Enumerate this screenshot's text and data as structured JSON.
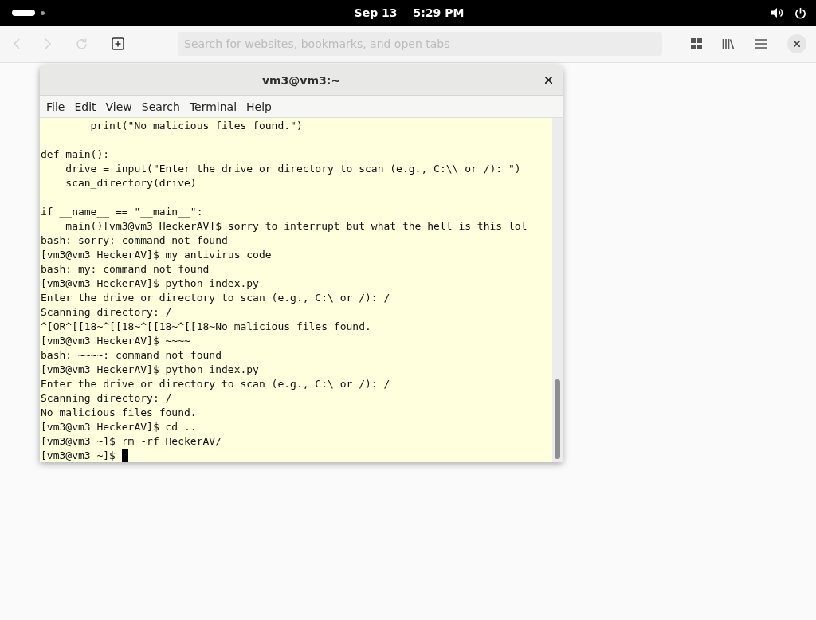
{
  "top_bar": {
    "date": "Sep 13",
    "time": "5:29 PM"
  },
  "browser": {
    "nav_buttons": [
      {
        "kind": "back",
        "disabled": true
      },
      {
        "kind": "forward",
        "disabled": true
      },
      {
        "kind": "reload",
        "disabled": true
      },
      {
        "kind": "new-tab",
        "disabled": false
      }
    ],
    "search": {
      "placeholder": "Search for websites, bookmarks, and open tabs"
    }
  },
  "terminal": {
    "title": "vm3@vm3:~",
    "menu": [
      "File",
      "Edit",
      "View",
      "Search",
      "Terminal",
      "Help"
    ],
    "blocks": [
      [
        "        print(\"No malicious files found.\")"
      ],
      [
        "def main():",
        "    drive = input(\"Enter the drive or directory to scan (e.g., C:\\\\ or /): \")",
        "    scan_directory(drive)"
      ],
      [
        "if __name__ == \"__main__\":",
        "    main()[vm3@vm3 HeckerAV]$ sorry to interrupt but what the hell is this lol",
        "bash: sorry: command not found",
        "[vm3@vm3 HeckerAV]$ my antivirus code",
        "bash: my: command not found",
        "[vm3@vm3 HeckerAV]$ python index.py",
        "Enter the drive or directory to scan (e.g., C:\\ or /): /",
        "Scanning directory: /",
        "^[OR^[[18~^[[18~^[[18~^[[18~No malicious files found.",
        "[vm3@vm3 HeckerAV]$ ~~~~",
        "bash: ~~~~: command not found",
        "[vm3@vm3 HeckerAV]$ python index.py",
        "Enter the drive or directory to scan (e.g., C:\\ or /): /",
        "Scanning directory: /",
        "No malicious files found.",
        "[vm3@vm3 HeckerAV]$ cd ..",
        "[vm3@vm3 ~]$ rm -rf HeckerAV/"
      ]
    ],
    "prompt": "[vm3@vm3 ~]$ "
  }
}
